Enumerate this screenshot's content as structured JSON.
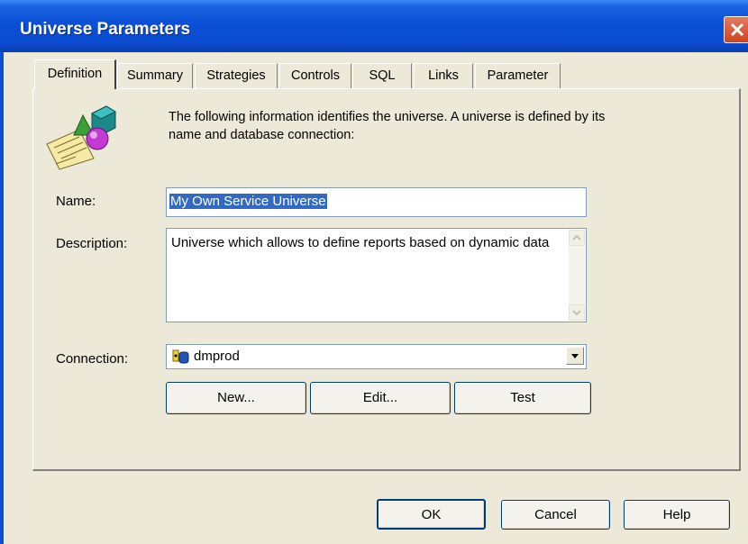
{
  "window": {
    "title": "Universe Parameters"
  },
  "tabs": [
    {
      "label": "Definition",
      "active": true
    },
    {
      "label": "Summary"
    },
    {
      "label": "Strategies"
    },
    {
      "label": "Controls"
    },
    {
      "label": "SQL"
    },
    {
      "label": "Links"
    },
    {
      "label": "Parameter"
    }
  ],
  "definition": {
    "intro": "The following information identifies the universe. A universe is defined by its name and database connection:",
    "name_label": "Name:",
    "name_value": "My Own Service Universe",
    "description_label": "Description:",
    "description_value": "Universe which allows to define reports based on dynamic data",
    "connection_label": "Connection:",
    "connection_value": "dmprod",
    "new_button": "New...",
    "edit_button": "Edit...",
    "test_button": "Test"
  },
  "footer": {
    "ok": "OK",
    "cancel": "Cancel",
    "help": "Help"
  },
  "icons": {
    "universe": "universe-shapes-icon",
    "connection": "database-connection-icon",
    "close": "close-icon"
  },
  "colors": {
    "titlebar": "#0a4fd6",
    "dialog_bg": "#ece9d8",
    "selection": "#316ac5",
    "close_button": "#cc4420"
  }
}
